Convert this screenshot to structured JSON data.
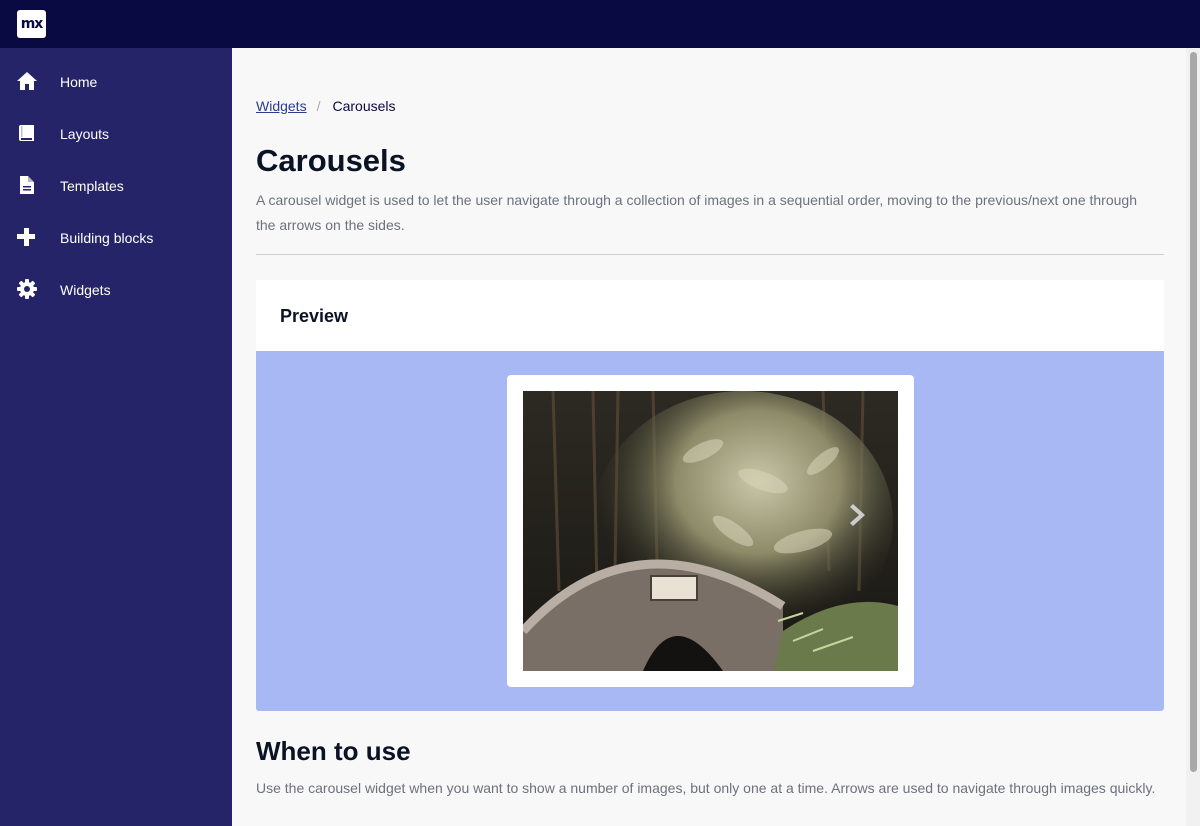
{
  "topbar": {
    "logo_text": "mx"
  },
  "sidebar": {
    "items": [
      {
        "label": "Home",
        "icon": "home-icon"
      },
      {
        "label": "Layouts",
        "icon": "book-icon"
      },
      {
        "label": "Templates",
        "icon": "file-icon"
      },
      {
        "label": "Building blocks",
        "icon": "plus-icon"
      },
      {
        "label": "Widgets",
        "icon": "gear-icon"
      }
    ]
  },
  "breadcrumb": {
    "parent": "Widgets",
    "separator": "/",
    "current": "Carousels"
  },
  "page": {
    "title": "Carousels",
    "description": "A carousel widget is used to let the user navigate through a collection of images in a sequential order, moving to the previous/next one through the arrows on the sides."
  },
  "preview": {
    "title": "Preview",
    "next_icon": "chevron-right-icon",
    "image": "bridge-bamboo-photo"
  },
  "when_to_use": {
    "title": "When to use",
    "description": "Use the carousel widget when you want to show a number of images, but only one at a time. Arrows are used to navigate through images quickly."
  },
  "colors": {
    "topbar": "#0a0a42",
    "sidebar": "#252468",
    "preview_bg": "#a8b8f5",
    "text_muted": "#6c717e"
  }
}
